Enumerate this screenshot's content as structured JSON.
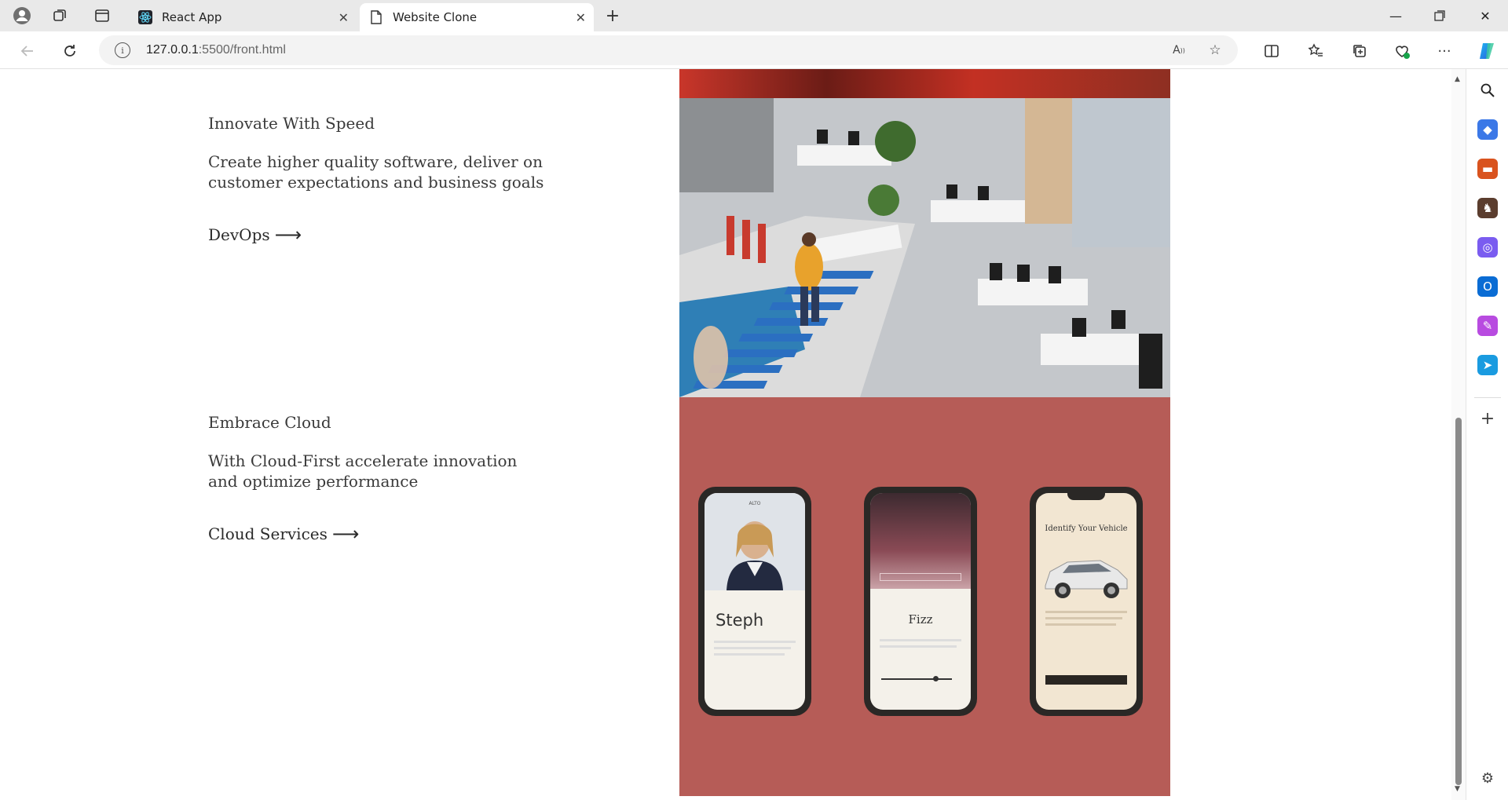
{
  "browser": {
    "tabs": [
      {
        "title": "React App",
        "active": false
      },
      {
        "title": "Website Clone",
        "active": true
      }
    ],
    "url_host": "127.0.0.1",
    "url_rest": ":5500/front.html",
    "new_tab_label": "+"
  },
  "sections": [
    {
      "heading": "Innovate With Speed",
      "description": "Create higher quality software, deliver on customer expectations and business goals",
      "link": "DevOps"
    },
    {
      "heading": "Embrace Cloud",
      "description": "With Cloud-First accelerate innovation and optimize performance",
      "link": "Cloud Services"
    }
  ],
  "phones": [
    {
      "name": "Steph",
      "brand": "ALTO"
    },
    {
      "name": "Fizz"
    },
    {
      "name": "Identify Your Vehicle"
    }
  ],
  "colors": {
    "cloud_background": "#b65c57",
    "edge_accent": "#0b6dd6"
  }
}
